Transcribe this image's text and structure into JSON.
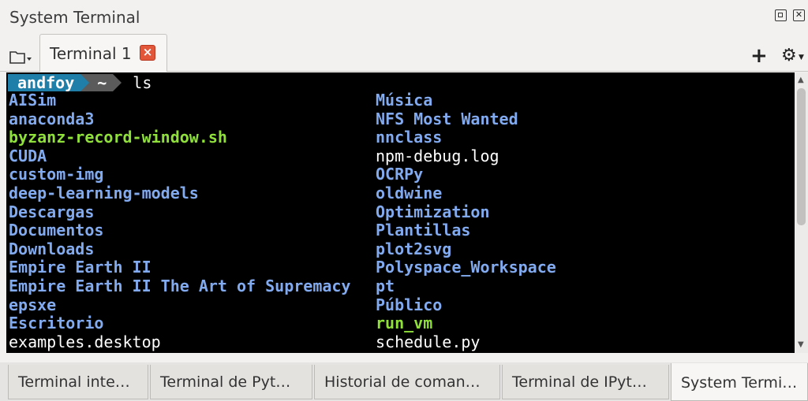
{
  "window": {
    "title": "System Terminal"
  },
  "top_tabs": {
    "active_tab": "Terminal 1",
    "close_icon": "×",
    "add_icon": "+",
    "settings_icon": "⚙"
  },
  "terminal": {
    "prompt_user": "andfoy",
    "prompt_dir": "~",
    "command": "ls",
    "left_column": [
      {
        "name": "AISim",
        "kind": "dir"
      },
      {
        "name": "anaconda3",
        "kind": "dir"
      },
      {
        "name": "byzanz-record-window.sh",
        "kind": "exec"
      },
      {
        "name": "CUDA",
        "kind": "dir"
      },
      {
        "name": "custom-img",
        "kind": "dir"
      },
      {
        "name": "deep-learning-models",
        "kind": "dir"
      },
      {
        "name": "Descargas",
        "kind": "dir"
      },
      {
        "name": "Documentos",
        "kind": "dir"
      },
      {
        "name": "Downloads",
        "kind": "dir"
      },
      {
        "name": "Empire Earth II",
        "kind": "dir"
      },
      {
        "name": "Empire Earth II The Art of Supremacy",
        "kind": "dir"
      },
      {
        "name": "epsxe",
        "kind": "dir"
      },
      {
        "name": "Escritorio",
        "kind": "dir"
      },
      {
        "name": "examples.desktop",
        "kind": "file"
      }
    ],
    "right_column": [
      {
        "name": "Música",
        "kind": "dir"
      },
      {
        "name": "NFS Most Wanted",
        "kind": "dir"
      },
      {
        "name": "nnclass",
        "kind": "dir"
      },
      {
        "name": "npm-debug.log",
        "kind": "file"
      },
      {
        "name": "OCRPy",
        "kind": "dir"
      },
      {
        "name": "oldwine",
        "kind": "dir"
      },
      {
        "name": "Optimization",
        "kind": "dir"
      },
      {
        "name": "Plantillas",
        "kind": "dir"
      },
      {
        "name": "plot2svg",
        "kind": "dir"
      },
      {
        "name": "Polyspace_Workspace",
        "kind": "dir"
      },
      {
        "name": "pt",
        "kind": "dir"
      },
      {
        "name": "Público",
        "kind": "dir"
      },
      {
        "name": "run_vm",
        "kind": "exec"
      },
      {
        "name": "schedule.py",
        "kind": "file"
      }
    ],
    "colors": {
      "background": "#000000",
      "directory": "#82aaee",
      "executable": "#8fe03a",
      "file": "#ffffff",
      "prompt_user_bg": "#1f7fa8",
      "prompt_dir_bg": "#5b5b5b"
    }
  },
  "bottom_tabs": [
    {
      "label": "Terminal inte…",
      "active": false
    },
    {
      "label": "Terminal de Pyt…",
      "active": false
    },
    {
      "label": "Historial de coman…",
      "active": false
    },
    {
      "label": "Terminal de IPyt…",
      "active": false
    },
    {
      "label": "System Termi…",
      "active": true
    }
  ]
}
